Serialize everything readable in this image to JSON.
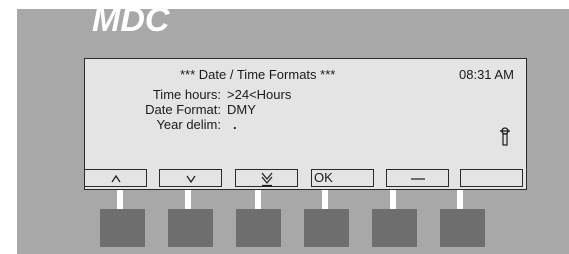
{
  "brand": {
    "logo_text": "MDC"
  },
  "screen": {
    "heading": "***  Date / Time Formats  ***",
    "clock": "08:31 AM",
    "fields": [
      {
        "label": "Time hours:",
        "value": ">24<Hours"
      },
      {
        "label": "Date Format:",
        "value": "DMY"
      },
      {
        "label": "Year delim:",
        "value": "."
      }
    ],
    "status_icon": "key-icon"
  },
  "softkeys": [
    {
      "label": "^",
      "icon": "caret-up-icon"
    },
    {
      "label": "v",
      "icon": "caret-down-icon"
    },
    {
      "label": "",
      "icon": "double-chevron-down-icon"
    },
    {
      "label": "OK",
      "icon": ""
    },
    {
      "label": "—",
      "icon": "dash-icon"
    },
    {
      "label": "",
      "icon": ""
    }
  ],
  "colors": {
    "panel": "#a8a8a8",
    "lcd": "#e4e4e4",
    "hardware_button": "#6e6e6e",
    "logo": "#ffffff"
  }
}
